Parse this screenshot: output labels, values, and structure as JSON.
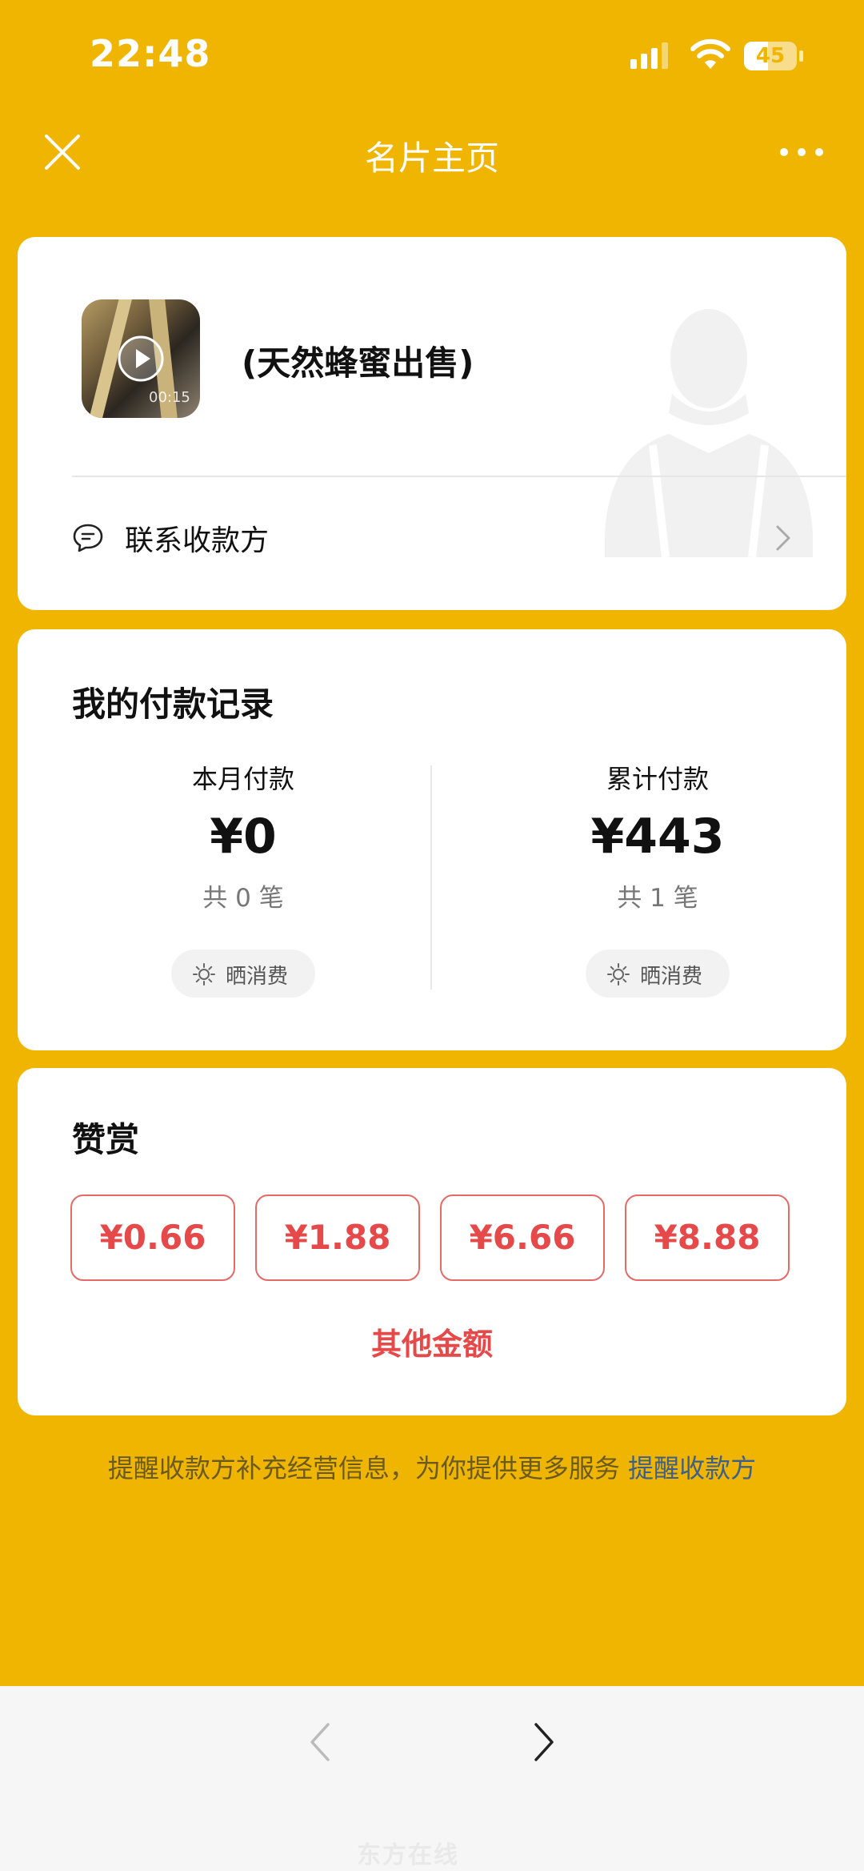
{
  "status_bar": {
    "time": "22:48",
    "battery": "45",
    "battery_level": 0.45
  },
  "nav": {
    "title": "名片主页",
    "close_icon": "close-icon",
    "more_icon": "more-dots-icon"
  },
  "merchant": {
    "name": "(天然蜂蜜出售)",
    "video_duration": "00:15",
    "contact_label": "联系收款方"
  },
  "payment_records": {
    "title": "我的付款记录",
    "this_month": {
      "label": "本月付款",
      "amount": "¥0",
      "count": "共 0 笔",
      "share_label": "晒消费"
    },
    "total": {
      "label": "累计付款",
      "amount": "¥443",
      "count": "共 1 笔",
      "share_label": "晒消费"
    }
  },
  "tip": {
    "title": "赞赏",
    "amounts": [
      "¥0.66",
      "¥1.88",
      "¥6.66",
      "¥8.88"
    ],
    "other_label": "其他金额"
  },
  "notice": {
    "text": "提醒收款方补充经营信息，为你提供更多服务 ",
    "link": "提醒收款方"
  },
  "watermark": "东方在线",
  "colors": {
    "background": "#EFB500",
    "accent_red": "#E5494A",
    "link_blue": "#3E5F8A"
  }
}
